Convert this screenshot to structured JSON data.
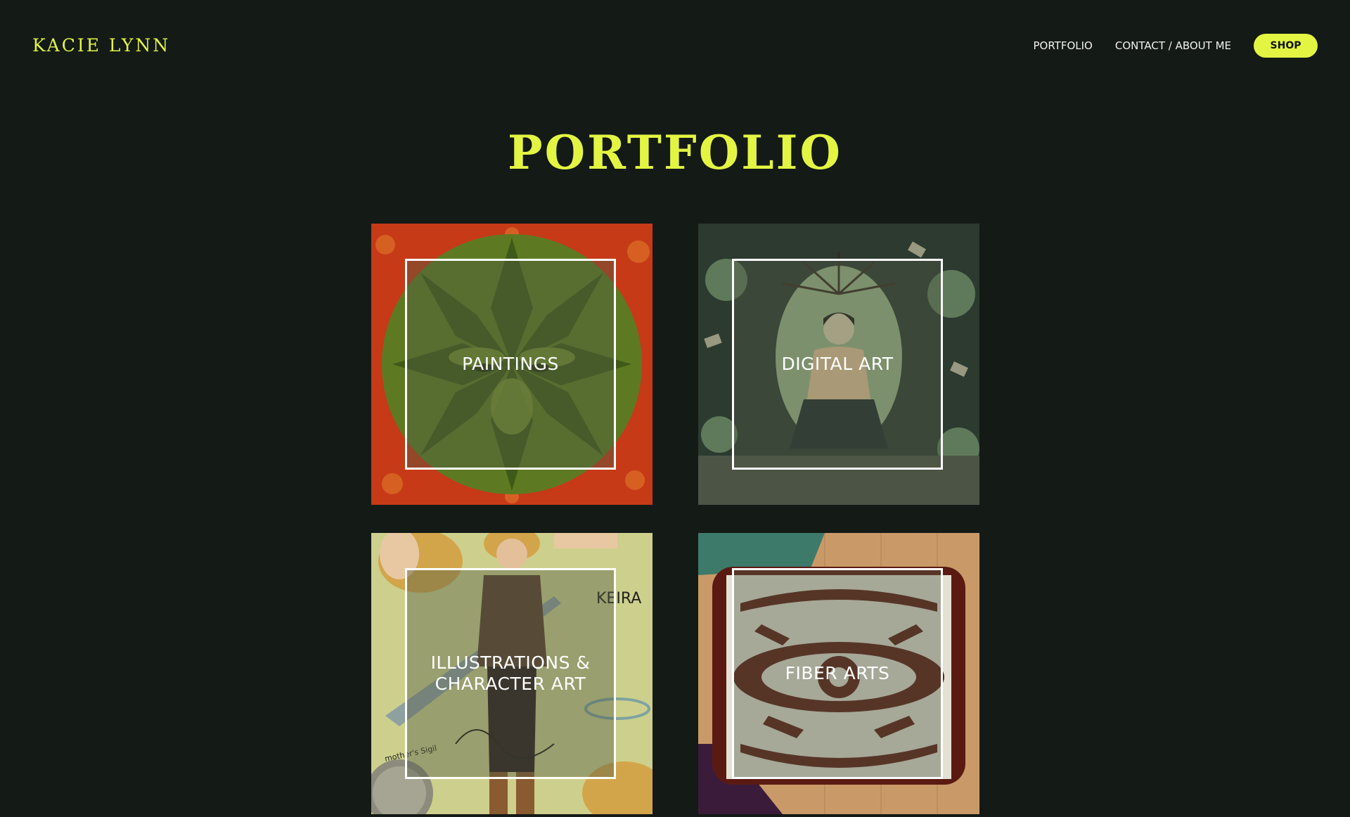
{
  "header": {
    "logo": "KACIE LYNN",
    "nav": [
      "PORTFOLIO",
      "CONTACT / ABOUT ME"
    ],
    "shop_label": "SHOP"
  },
  "main": {
    "title": "PORTFOLIO",
    "tiles": [
      {
        "label": "PAINTINGS"
      },
      {
        "label": "DIGITAL ART"
      },
      {
        "label": "ILLUSTRATIONS &\nCHARACTER ART"
      },
      {
        "label": "FIBER ARTS"
      }
    ],
    "illustration_text": {
      "name": "KEIRA",
      "caption": "mother's Sigil"
    }
  },
  "colors": {
    "background": "#141a16",
    "accent": "#e3f542",
    "text": "#ffffff"
  }
}
